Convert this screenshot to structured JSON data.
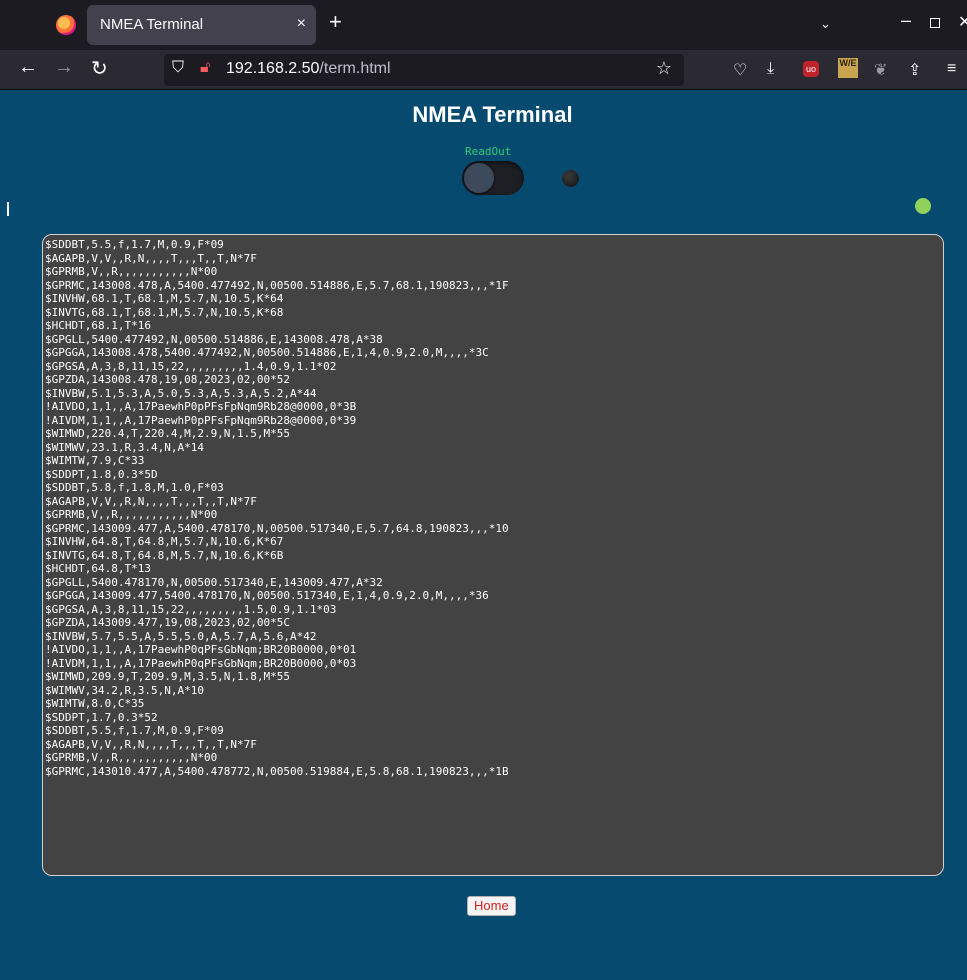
{
  "browser": {
    "tab_title": "NMEA Terminal",
    "tab_close": "×",
    "new_tab": "+",
    "tabs_list": "⌄",
    "url_host": "192.168.2.50",
    "url_path": "/term.html",
    "icons": [
      "firefox-logo",
      "back-arrow",
      "forward-arrow",
      "reload",
      "shield",
      "lock-warning",
      "star",
      "pocket",
      "download",
      "ublock",
      "extension-we",
      "extension-grey",
      "share",
      "menu",
      "minimize",
      "maximize",
      "close"
    ],
    "ext_we_label": "W/E"
  },
  "page": {
    "title": "NMEA Terminal",
    "readout_label": "ReadOut",
    "readout_on": false,
    "home_label": "Home"
  },
  "terminal": {
    "lines": [
      "$SDDBT,5.5,f,1.7,M,0.9,F*09",
      "$AGAPB,V,V,,R,N,,,,T,,,T,,T,N*7F",
      "$GPRMB,V,,R,,,,,,,,,,,N*00",
      "$GPRMC,143008.478,A,5400.477492,N,00500.514886,E,5.7,68.1,190823,,,*1F",
      "$INVHW,68.1,T,68.1,M,5.7,N,10.5,K*64",
      "$INVTG,68.1,T,68.1,M,5.7,N,10.5,K*68",
      "$HCHDT,68.1,T*16",
      "$GPGLL,5400.477492,N,00500.514886,E,143008.478,A*38",
      "$GPGGA,143008.478,5400.477492,N,00500.514886,E,1,4,0.9,2.0,M,,,,*3C",
      "$GPGSA,A,3,8,11,15,22,,,,,,,,,1.4,0.9,1.1*02",
      "$GPZDA,143008.478,19,08,2023,02,00*52",
      "$INVBW,5.1,5.3,A,5.0,5.3,A,5.3,A,5.2,A*44",
      "!AIVDO,1,1,,A,17PaewhP0pPFsFpNqm9Rb28@0000,0*3B",
      "!AIVDM,1,1,,A,17PaewhP0pPFsFpNqm9Rb28@0000,0*39",
      "$WIMWD,220.4,T,220.4,M,2.9,N,1.5,M*55",
      "$WIMWV,23.1,R,3.4,N,A*14",
      "$WIMTW,7.9,C*33",
      "$SDDPT,1.8,0.3*5D",
      "$SDDBT,5.8,f,1.8,M,1.0,F*03",
      "$AGAPB,V,V,,R,N,,,,T,,,T,,T,N*7F",
      "$GPRMB,V,,R,,,,,,,,,,,N*00",
      "$GPRMC,143009.477,A,5400.478170,N,00500.517340,E,5.7,64.8,190823,,,*10",
      "$INVHW,64.8,T,64.8,M,5.7,N,10.6,K*67",
      "$INVTG,64.8,T,64.8,M,5.7,N,10.6,K*6B",
      "$HCHDT,64.8,T*13",
      "$GPGLL,5400.478170,N,00500.517340,E,143009.477,A*32",
      "$GPGGA,143009.477,5400.478170,N,00500.517340,E,1,4,0.9,2.0,M,,,,*36",
      "$GPGSA,A,3,8,11,15,22,,,,,,,,,1.5,0.9,1.1*03",
      "$GPZDA,143009.477,19,08,2023,02,00*5C",
      "$INVBW,5.7,5.5,A,5.5,5.0,A,5.7,A,5.6,A*42",
      "!AIVDO,1,1,,A,17PaewhP0qPFsGbNqm;BR20B0000,0*01",
      "!AIVDM,1,1,,A,17PaewhP0qPFsGbNqm;BR20B0000,0*03",
      "$WIMWD,209.9,T,209.9,M,3.5,N,1.8,M*55",
      "$WIMWV,34.2,R,3.5,N,A*10",
      "$WIMTW,8.0,C*35",
      "$SDDPT,1.7,0.3*52",
      "$SDDBT,5.5,f,1.7,M,0.9,F*09",
      "$AGAPB,V,V,,R,N,,,,T,,,T,,T,N*7F",
      "$GPRMB,V,,R,,,,,,,,,,,N*00",
      "$GPRMC,143010.477,A,5400.478772,N,00500.519884,E,5.8,68.1,190823,,,*1B"
    ]
  },
  "colors": {
    "page_bg": "#064a70",
    "terminal_bg": "#434343",
    "readout_label": "#2ecc71",
    "status_led": "#8fd15a",
    "home_text": "#d62020"
  }
}
